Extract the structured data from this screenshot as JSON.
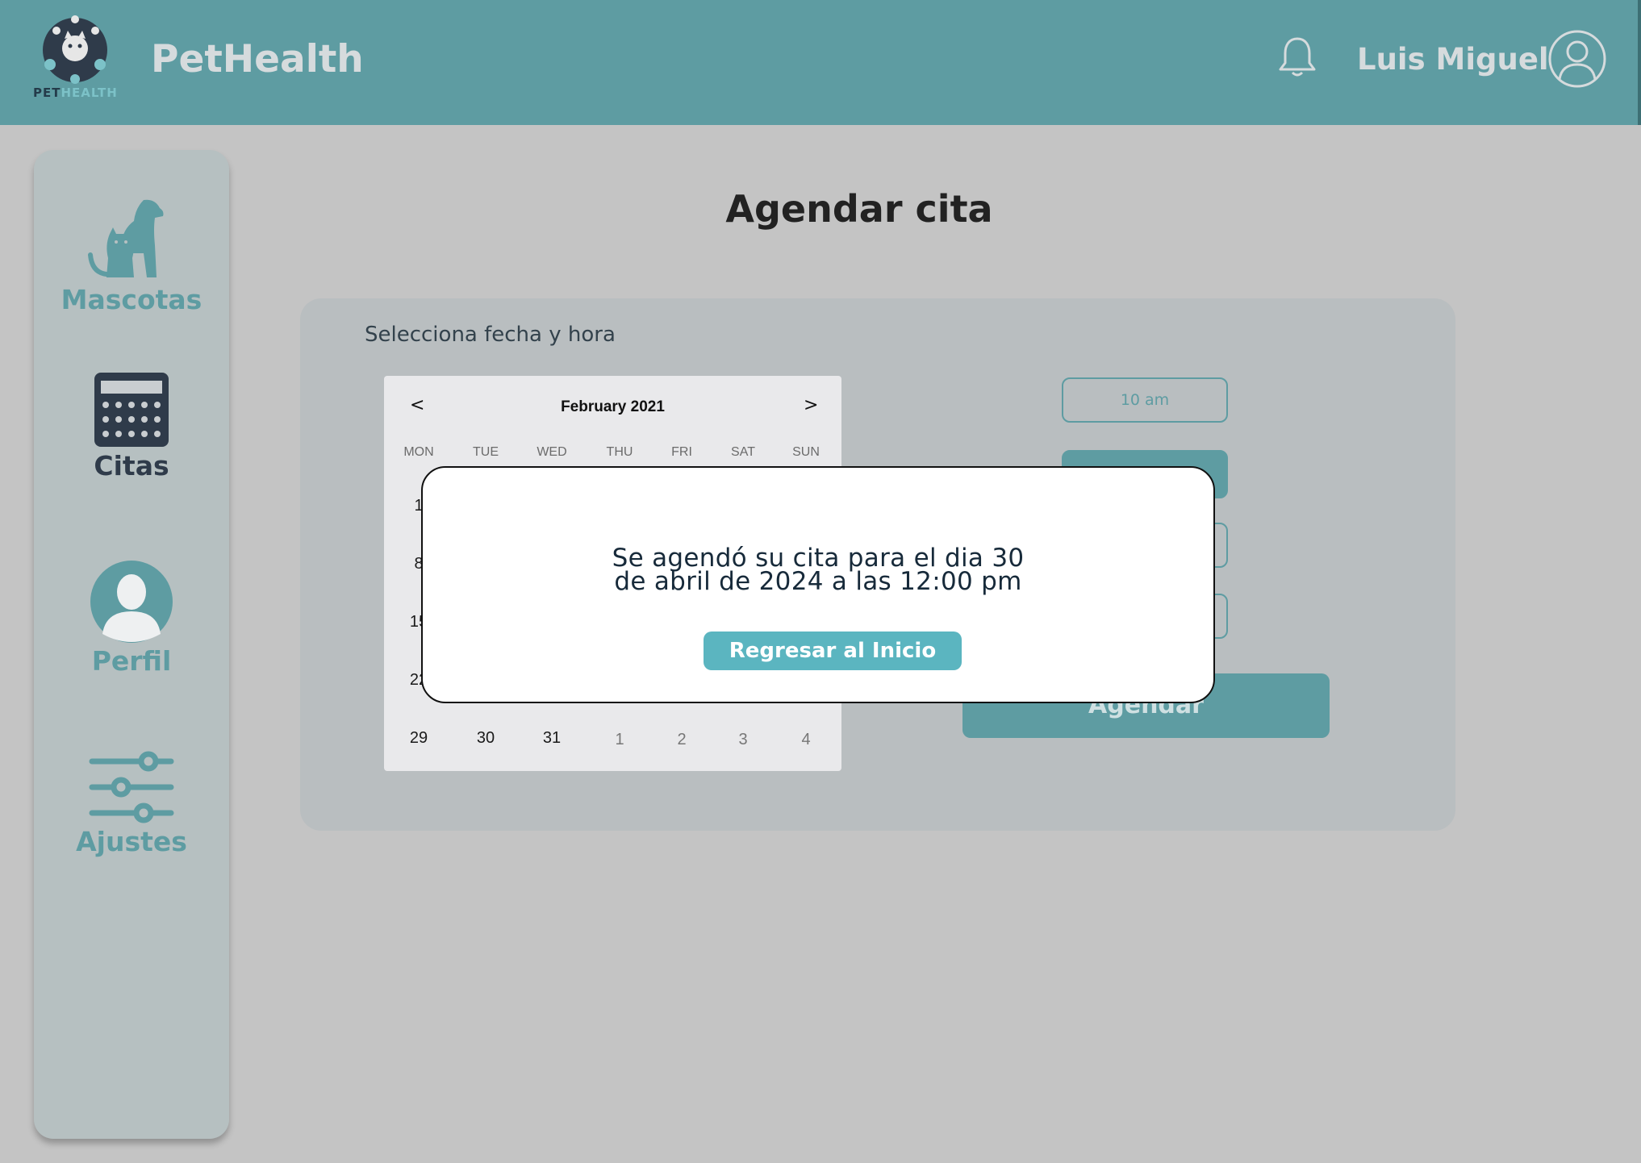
{
  "header": {
    "logo_text_part1": "PET",
    "logo_text_part2": "HEALTH",
    "brand": "PetHealth",
    "user_name": "Luis Miguel"
  },
  "sidebar": {
    "items": [
      {
        "label": "Mascotas",
        "icon": "pets-icon"
      },
      {
        "label": "Citas",
        "icon": "calendar-icon",
        "active": true
      },
      {
        "label": "Perfil",
        "icon": "profile-icon"
      },
      {
        "label": "Ajustes",
        "icon": "sliders-icon"
      }
    ]
  },
  "main": {
    "title": "Agendar cita",
    "select_label": "Selecciona fecha y hora",
    "schedule_button": "Agendar"
  },
  "calendar": {
    "prev": "<",
    "next": ">",
    "month": "February 2021",
    "weekdays": [
      "MON",
      "TUE",
      "WED",
      "THU",
      "FRI",
      "SAT",
      "SUN"
    ],
    "first_column_days": [
      "1",
      "8",
      "15",
      "22"
    ],
    "last_row": [
      "29",
      "30",
      "31",
      "1",
      "2",
      "3",
      "4"
    ]
  },
  "time_slots": [
    {
      "label": "10 am",
      "selected": false
    },
    {
      "label": "",
      "selected": true
    },
    {
      "label": "",
      "selected": false
    },
    {
      "label": "",
      "selected": false
    }
  ],
  "modal": {
    "line1": "Se agendó su cita para el dia 30",
    "line2": "de abril de 2024 a las 12:00 pm",
    "button": "Regresar al Inicio"
  },
  "colors": {
    "primary": "#5e9ca2",
    "accent": "#5bb5c0",
    "dark": "#2f3b4a",
    "overlay_bg": "#c4c4c4"
  }
}
